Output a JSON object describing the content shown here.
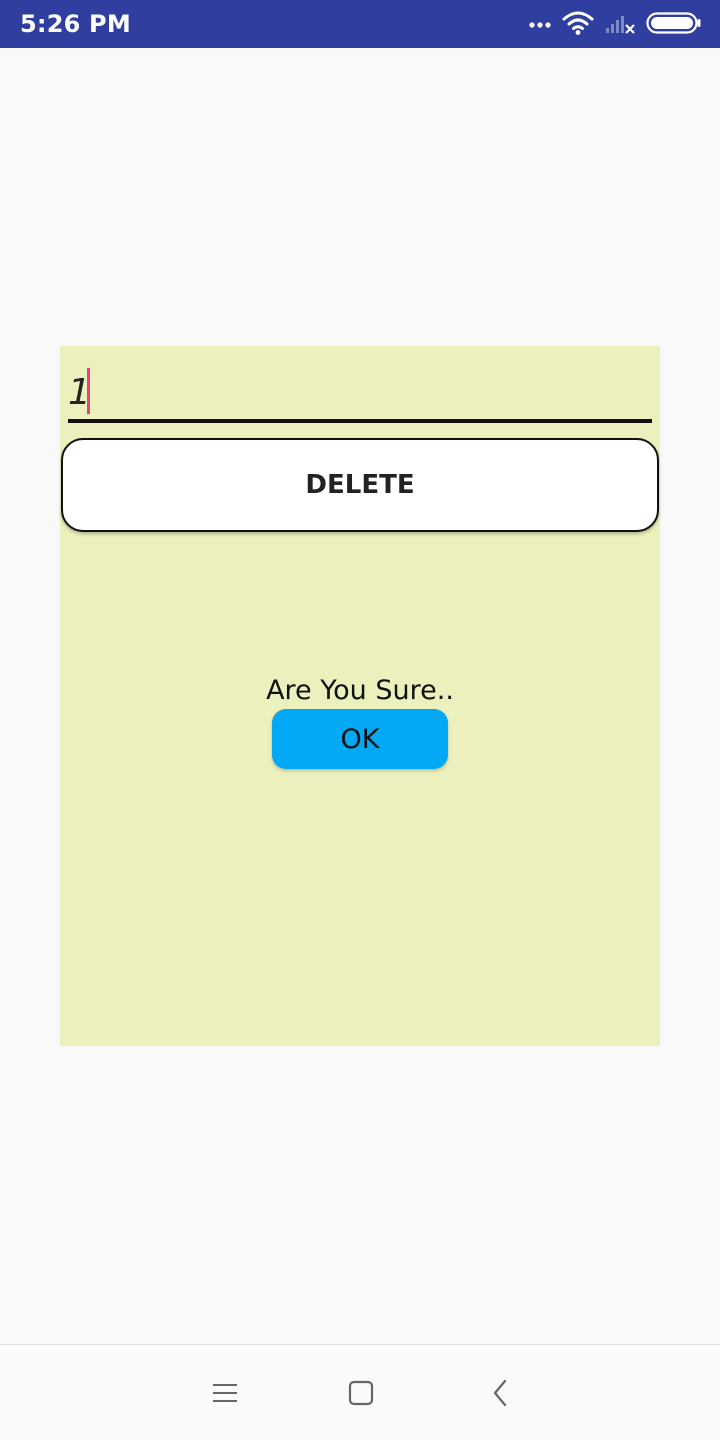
{
  "status_bar": {
    "time": "5:26 PM",
    "icons": [
      "more-dots-icon",
      "wifi-icon",
      "no-signal-icon",
      "battery-icon"
    ]
  },
  "form": {
    "input_value": "1",
    "delete_label": "DELETE"
  },
  "dialog": {
    "message": "Are You Sure..",
    "ok_label": "OK"
  },
  "nav_bar": {
    "icons": [
      "menu-icon",
      "home-icon",
      "back-icon"
    ]
  },
  "colors": {
    "status_bar": "#303f9f",
    "panel": "#ebf0bc",
    "ok_button": "#03a9f4",
    "caret": "#e0457b"
  }
}
